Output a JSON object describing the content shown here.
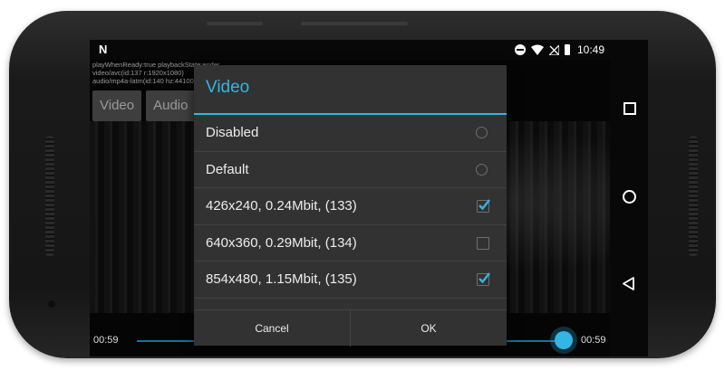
{
  "status_bar": {
    "notification_icon": "N",
    "time": "10:49",
    "icons": [
      "do-not-disturb-icon",
      "wifi-icon",
      "no-signal-icon",
      "battery-icon"
    ]
  },
  "debug": {
    "lines": [
      "playWhenReady:true playbackState:ended item:0/1/3/9",
      "video/avc(id:137 r:1920x1080)",
      "audio/mp4a-latm(id:140 hz:44100)"
    ]
  },
  "track_buttons": [
    "Video",
    "Audio"
  ],
  "player": {
    "current_time": "00:59",
    "duration": "00:59",
    "progress": 1.0
  },
  "dialog": {
    "title": "Video",
    "options": [
      {
        "label": "Disabled",
        "control": "radio",
        "checked": false
      },
      {
        "label": "Default",
        "control": "radio",
        "checked": false
      },
      {
        "label": "426x240, 0.24Mbit,  (133)",
        "control": "checkbox",
        "checked": true
      },
      {
        "label": "640x360, 0.29Mbit,  (134)",
        "control": "checkbox",
        "checked": false
      },
      {
        "label": "854x480, 1.15Mbit,  (135)",
        "control": "checkbox",
        "checked": true
      }
    ],
    "cancel_label": "Cancel",
    "ok_label": "OK"
  },
  "colors": {
    "accent": "#33b5e5",
    "dialog_bg": "#323232"
  }
}
